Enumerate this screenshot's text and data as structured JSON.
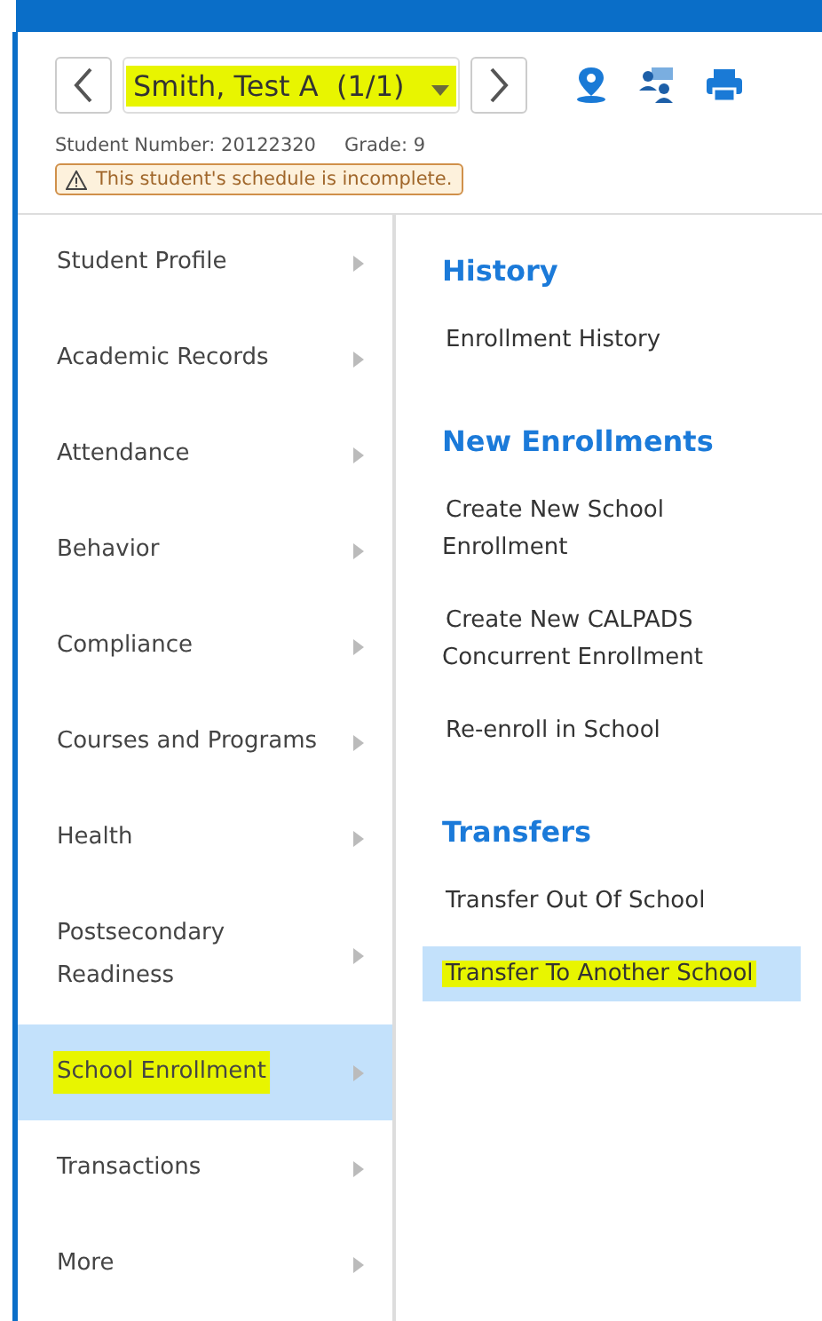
{
  "student": {
    "name": "Smith, Test A  (1/1)",
    "highlighted": true,
    "number": "Student Number: 20122320",
    "grade": "Grade: 9",
    "warning": "This student's schedule is incomplete."
  },
  "sidebar": {
    "items": [
      {
        "label": "Student Profile",
        "selected": false,
        "highlighted": false
      },
      {
        "label": "Academic Records",
        "selected": false,
        "highlighted": false
      },
      {
        "label": "Attendance",
        "selected": false,
        "highlighted": false
      },
      {
        "label": "Behavior",
        "selected": false,
        "highlighted": false
      },
      {
        "label": "Compliance",
        "selected": false,
        "highlighted": false
      },
      {
        "label": "Courses and Programs",
        "selected": false,
        "highlighted": false
      },
      {
        "label": "Health",
        "selected": false,
        "highlighted": false
      },
      {
        "label": "Postsecondary Readiness",
        "selected": false,
        "highlighted": false
      },
      {
        "label": "School Enrollment",
        "selected": true,
        "highlighted": true
      },
      {
        "label": "Transactions",
        "selected": false,
        "highlighted": false
      },
      {
        "label": "More",
        "selected": false,
        "highlighted": false
      }
    ]
  },
  "sections": [
    {
      "title": "History",
      "links": [
        {
          "label": "Enrollment History",
          "selected": false,
          "highlighted": false
        }
      ]
    },
    {
      "title": "New Enrollments",
      "links": [
        {
          "label": "Create New School Enrollment",
          "selected": false,
          "highlighted": false
        },
        {
          "label": "Create New CALPADS Concurrent Enrollment",
          "selected": false,
          "highlighted": false
        },
        {
          "label": "Re-enroll in School",
          "selected": false,
          "highlighted": false
        }
      ]
    },
    {
      "title": "Transfers",
      "links": [
        {
          "label": "Transfer Out Of School",
          "selected": false,
          "highlighted": false
        },
        {
          "label": "Transfer To Another School",
          "selected": true,
          "highlighted": true
        }
      ]
    }
  ]
}
